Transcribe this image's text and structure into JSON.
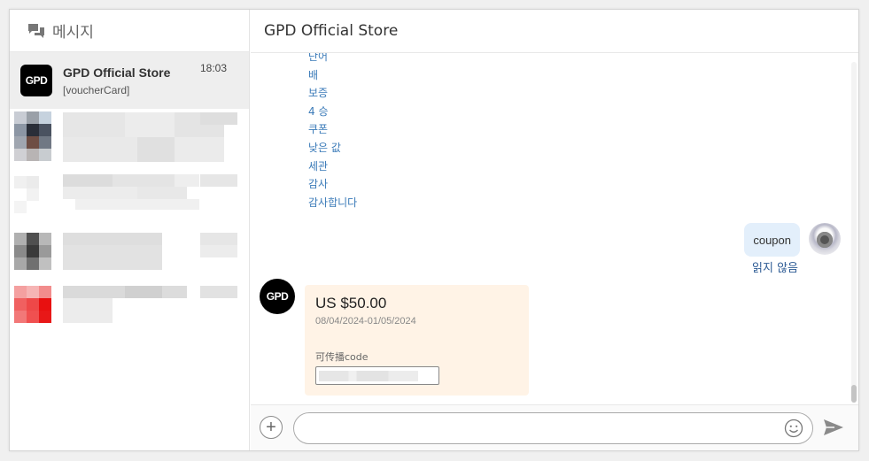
{
  "sidebar": {
    "header": {
      "title": "메시지",
      "icon": "chat-bubbles-icon"
    },
    "conversations": [
      {
        "logo": "GPD",
        "name": "GPD Official Store",
        "preview": "[voucherCard]",
        "time": "18:03"
      }
    ]
  },
  "chat": {
    "title": "GPD Official Store",
    "text_lines": [
      "단어",
      "배",
      "보증",
      "4 승",
      "쿠폰",
      "낮은 값",
      "세관",
      "감사",
      "감사합니다"
    ],
    "outgoing": {
      "text": "coupon",
      "status": "읽지 않음"
    },
    "incoming_avatar": "GPD",
    "voucher": {
      "amount": "US $50.00",
      "dates": "08/04/2024-01/05/2024",
      "code_label": "可传播code"
    }
  },
  "composer": {
    "add_icon": "plus-circle-icon",
    "input_value": "",
    "emoji_icon": "smiley-icon",
    "send_icon": "send-arrow-icon"
  },
  "colors": {
    "link_text": "#3a7ab8",
    "outgoing_bubble": "#e3effb",
    "voucher_bg": "#fff3e6",
    "selected_conversation": "#eeeeee"
  }
}
